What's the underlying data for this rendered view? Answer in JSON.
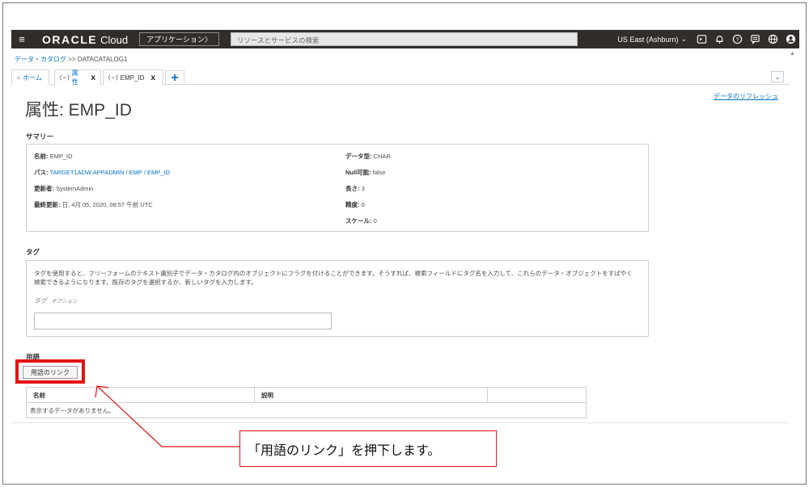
{
  "topbar": {
    "brand_oracle": "ORACLE",
    "brand_cloud": "Cloud",
    "applications_button": "アプリケーション〉",
    "search_placeholder": "リソースとサービスの検索",
    "region": "US East (Ashburn)",
    "icons": [
      "cloud-shell-icon",
      "bell-icon",
      "help-icon",
      "chat-icon",
      "globe-icon",
      "user-icon"
    ]
  },
  "breadcrumb": {
    "link": "データ・カタログ",
    "separator": ">>",
    "current": "DATACATALOG1"
  },
  "tabs": [
    {
      "icon": "home-icon",
      "label": "ホーム"
    },
    {
      "icon": "attribute-icon",
      "prefix": "(⇔)",
      "label": "属性",
      "close": "x"
    },
    {
      "icon": "attribute-icon",
      "prefix": "(⇔)",
      "label": "EMP_ID",
      "close": "x"
    }
  ],
  "add_tab": "+",
  "refresh_link": "データのリフレッシュ",
  "page_title": "属性:  EMP_ID",
  "summary": {
    "heading": "サマリー",
    "left": [
      {
        "key": "名前:",
        "value": "EMP_ID"
      },
      {
        "key": "パス:",
        "value": "TARGET1ADW.APPADMIN  / EMP  / EMP_ID"
      },
      {
        "key": "更新者:",
        "value": "SystemAdmin"
      },
      {
        "key": "最終更新:",
        "value": "日, 4月 05, 2020, 08:57 午前 UTC"
      }
    ],
    "right": [
      {
        "key": "データ型:",
        "value": "CHAR"
      },
      {
        "key": "Null可能:",
        "value": "false"
      },
      {
        "key": "長さ:",
        "value": "3"
      },
      {
        "key": "精度:",
        "value": "0"
      },
      {
        "key": "スケール:",
        "value": "0"
      }
    ]
  },
  "tags": {
    "heading": "タグ",
    "description": "タグを使用すると、フリーフォームのテキスト識別子でデータ・カタログ内のオブジェクトにフラグを付けることができます。そうすれば、検索フィールドにタグ名を入力して、これらのデータ・オブジェクトをすばやく検索できるようになります。既存のタグを選択するか、新しいタグを入力します。",
    "label": "タグ",
    "label_hint": "オプション",
    "input_value": ""
  },
  "glossary": {
    "heading": "用語",
    "link_button": "用語のリンク",
    "columns": [
      "名前",
      "説明",
      ""
    ],
    "empty_message": "表示するデータがありません。"
  },
  "annotation": {
    "callout": "「用語のリンク」を押下します。",
    "color": "#e31313"
  },
  "colors": {
    "topbar": "#312d2a",
    "link": "#0572ce",
    "highlight": "#e31313"
  }
}
